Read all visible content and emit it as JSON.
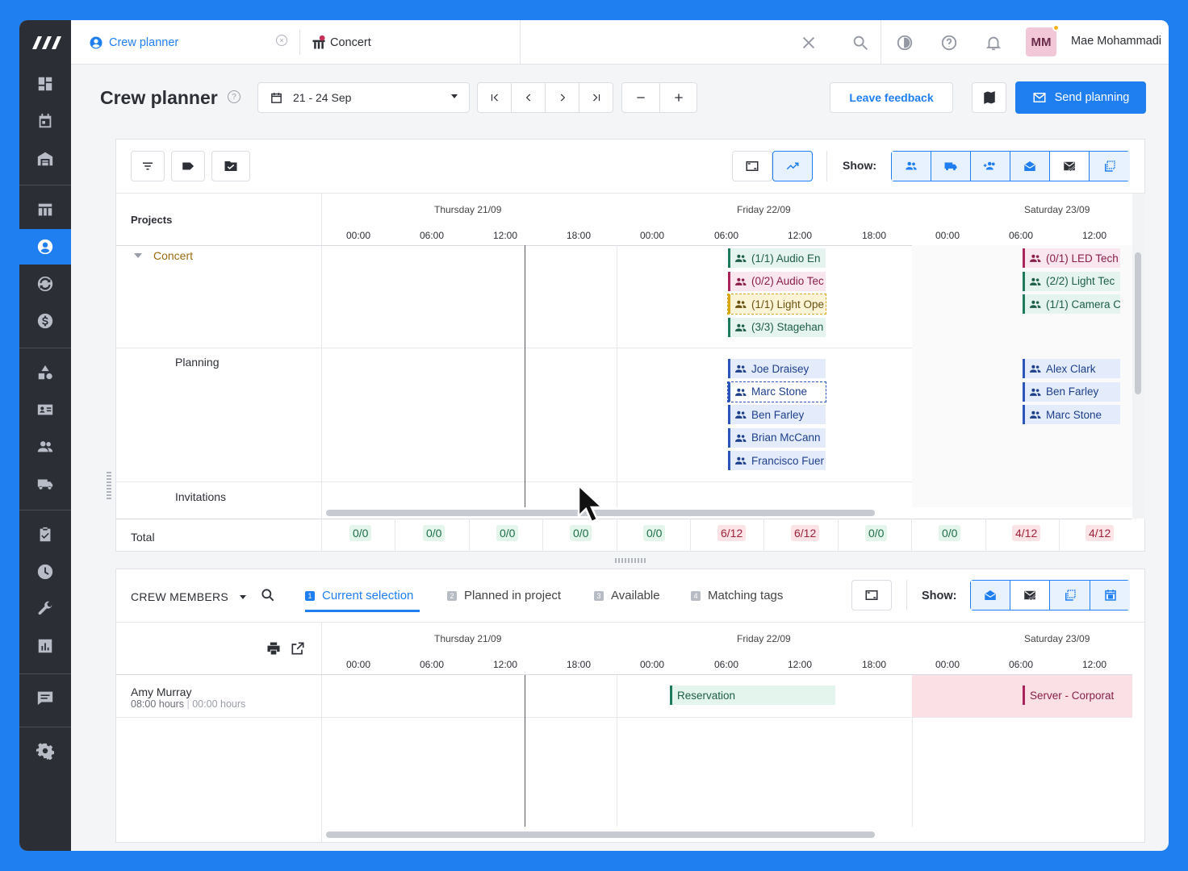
{
  "nav": {
    "logo_text": "///",
    "items": [
      "dashboard-icon",
      "calendar-icon",
      "warehouse-icon",
      "table-icon",
      "crew-planner-icon",
      "sync-icon",
      "dollar-icon",
      "shapes-icon",
      "id-card-icon",
      "people-icon",
      "truck-icon",
      "checklist-icon",
      "clock-icon",
      "wrench-icon",
      "report-icon",
      "message-icon",
      "settings-icon"
    ]
  },
  "topbar": {
    "tab_active": "Crew planner",
    "tab_second": "Concert",
    "user_initials": "MM",
    "user_name": "Mae Mohammadi"
  },
  "toolbar": {
    "title": "Crew planner",
    "date_range": "21 - 24 Sep",
    "leave_feedback": "Leave feedback",
    "send_planning": "Send planning"
  },
  "planner": {
    "show_label": "Show:",
    "projects_header": "Projects",
    "days": [
      "Thursday 21/09",
      "Friday 22/09",
      "Saturday 23/09"
    ],
    "hours": [
      "00:00",
      "06:00",
      "12:00",
      "18:00",
      "00:00",
      "06:00",
      "12:00",
      "18:00",
      "00:00",
      "06:00",
      "12:00"
    ],
    "project_name": "Concert",
    "row_planning": "Planning",
    "row_invitations": "Invitations",
    "row_total": "Total",
    "friday_functions": [
      {
        "label": "(1/1) Audio En",
        "style": "green"
      },
      {
        "label": "(0/2) Audio Tec",
        "style": "pink"
      },
      {
        "label": "(1/1) Light Ope",
        "style": "yellow"
      },
      {
        "label": "(3/3) Stagehan",
        "style": "green"
      }
    ],
    "saturday_functions": [
      {
        "label": "(0/1) LED Tech",
        "style": "pink"
      },
      {
        "label": "(2/2) Light Tec",
        "style": "green"
      },
      {
        "label": "(1/1) Camera C",
        "style": "green"
      }
    ],
    "friday_crew": [
      "Joe Draisey",
      "Marc Stone",
      "Ben Farley",
      "Brian McCann",
      "Francisco Fuer"
    ],
    "saturday_crew": [
      "Alex Clark",
      "Ben Farley",
      "Marc Stone"
    ],
    "totals": [
      {
        "v": "0/0",
        "s": "g"
      },
      {
        "v": "0/0",
        "s": "g"
      },
      {
        "v": "0/0",
        "s": "g"
      },
      {
        "v": "0/0",
        "s": "g"
      },
      {
        "v": "0/0",
        "s": "g"
      },
      {
        "v": "6/12",
        "s": "r"
      },
      {
        "v": "6/12",
        "s": "r"
      },
      {
        "v": "0/0",
        "s": "g"
      },
      {
        "v": "0/0",
        "s": "g"
      },
      {
        "v": "4/12",
        "s": "r"
      },
      {
        "v": "4/12",
        "s": "r"
      }
    ]
  },
  "crew_members": {
    "title": "CREW MEMBERS",
    "tabs": [
      {
        "n": "1",
        "label": "Current selection"
      },
      {
        "n": "2",
        "label": "Planned in project"
      },
      {
        "n": "3",
        "label": "Available"
      },
      {
        "n": "4",
        "label": "Matching tags"
      }
    ],
    "show_label": "Show:",
    "member_name": "Amy Murray",
    "member_hours": "08:00 hours",
    "member_hours2": "00:00 hours",
    "reservation": "Reservation",
    "server_booking": "Server - Corporat"
  },
  "colors": {
    "accent": "#1f7ef0",
    "sidebar": "#2c2e35"
  }
}
